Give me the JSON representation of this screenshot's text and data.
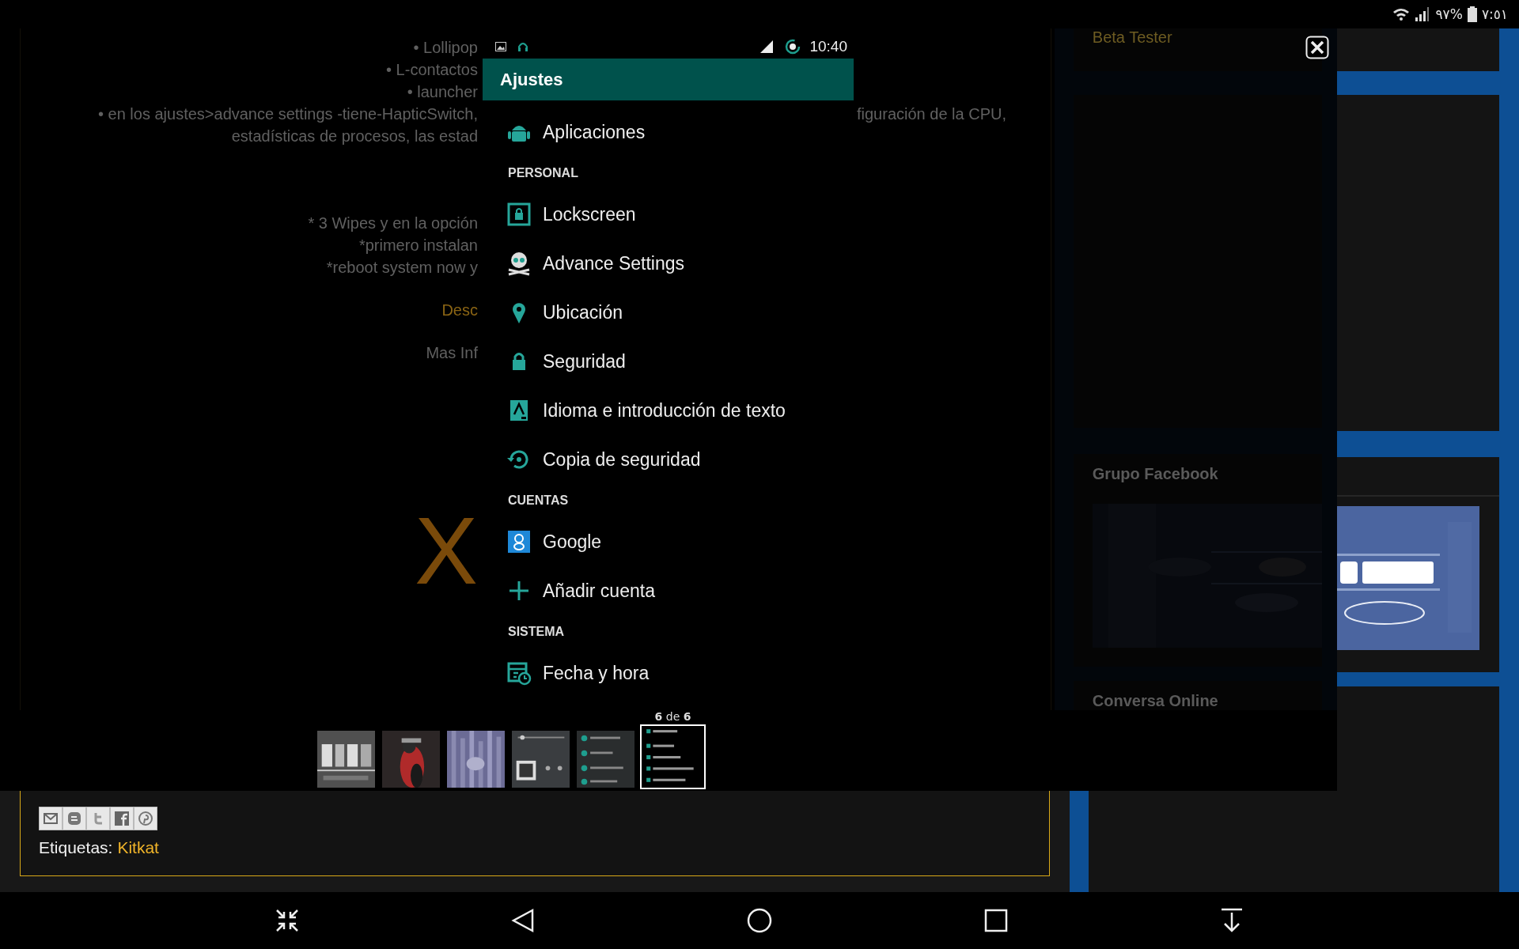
{
  "status_bar": {
    "battery": "٩٧%",
    "time": "٧:٥١"
  },
  "blog": {
    "paragraphs": [
      [
        {
          "text": "• Lollipop",
          "kind": "text"
        },
        {
          "text": "• L-contactos",
          "kind": "text"
        },
        {
          "text": "• launcher",
          "kind": "text"
        },
        {
          "text": "• en los ajustes>advance settings -tiene-HapticSwitch,",
          "kind": "text"
        },
        {
          "text": "estadísticas de procesos, las estad",
          "kind": "text"
        }
      ],
      [
        {
          "text": "* 3 Wipes y en la opción",
          "kind": "text"
        },
        {
          "text": "*primero instalan",
          "kind": "text"
        },
        {
          "text": "*reboot system now y",
          "kind": "text"
        }
      ],
      [
        {
          "text": "Desc",
          "kind": "link"
        }
      ],
      [
        {
          "text": "Mas Inf",
          "kind": "text"
        }
      ]
    ],
    "continued_text": "figuración de la CPU,",
    "big_letter": "X",
    "tags_label": "Etiquetas:",
    "tag": "Kitkat"
  },
  "lightbox": {
    "phone": {
      "time": "10:40",
      "title": "Ajustes",
      "items": [
        {
          "kind": "item",
          "label": "Aplicaciones"
        },
        {
          "kind": "header",
          "label": "PERSONAL"
        },
        {
          "kind": "item",
          "label": "Lockscreen"
        },
        {
          "kind": "item",
          "label": "Advance Settings"
        },
        {
          "kind": "item",
          "label": "Ubicación"
        },
        {
          "kind": "item",
          "label": "Seguridad"
        },
        {
          "kind": "item",
          "label": "Idioma e introducción de texto"
        },
        {
          "kind": "item",
          "label": "Copia de seguridad"
        },
        {
          "kind": "header",
          "label": "CUENTAS"
        },
        {
          "kind": "item",
          "label": "Google"
        },
        {
          "kind": "item",
          "label": "Añadir cuenta"
        },
        {
          "kind": "header",
          "label": "SISTEMA"
        },
        {
          "kind": "item",
          "label": "Fecha y hora"
        }
      ]
    },
    "counter": "**6** de **6**",
    "thumbnails": [
      {
        "kind": "picture",
        "selected": false
      },
      {
        "kind": "picture",
        "selected": false
      },
      {
        "kind": "picture",
        "selected": false
      },
      {
        "kind": "picture",
        "selected": false
      },
      {
        "kind": "picture",
        "selected": false
      },
      {
        "kind": "picture",
        "selected": true
      }
    ]
  },
  "sidebar": {
    "widgets": [
      {
        "title": "Beta Tester"
      },
      {
        "title": "Grupo Facebook"
      },
      {
        "title": "Conversa Online"
      }
    ]
  }
}
